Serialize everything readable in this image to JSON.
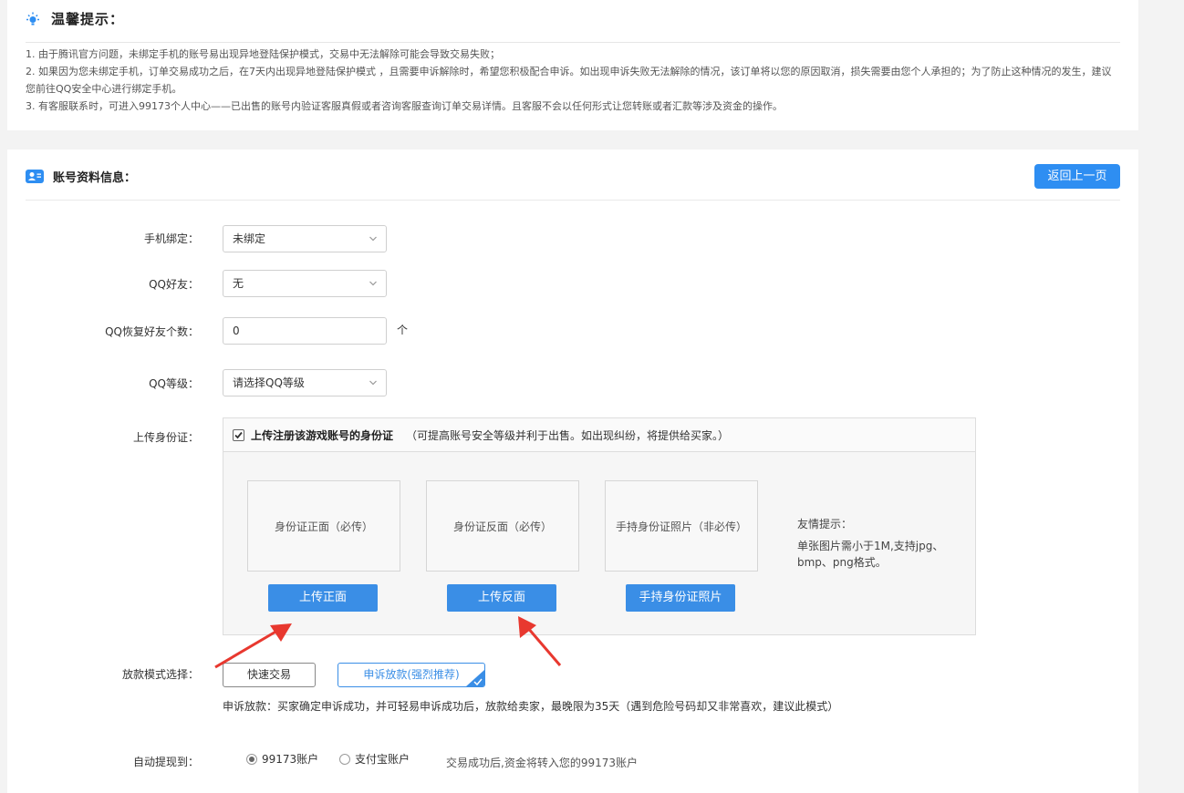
{
  "tips": {
    "title": "温馨提示：",
    "icon": "bulb-icon",
    "lines": [
      "1. 由于腾讯官方问题，未绑定手机的账号易出现异地登陆保护模式，交易中无法解除可能会导致交易失败；",
      "2. 如果因为您未绑定手机，订单交易成功之后，在7天内出现异地登陆保护模式 ，且需要申诉解除时，希望您积极配合申诉。如出现申诉失败无法解除的情况，该订单将以您的原因取消，损失需要由您个人承担的；为了防止这种情况的发生，建议您前往QQ安全中心进行绑定手机。",
      "3. 有客服联系时，可进入99173个人中心——已出售的账号内验证客服真假或者咨询客服查询订单交易详情。且客服不会以任何形式让您转账或者汇款等涉及资金的操作。"
    ]
  },
  "account_info": {
    "title": "账号资料信息：",
    "icon": "user-card-icon",
    "back_label": "返回上一页"
  },
  "form": {
    "phone_bind": {
      "label": "手机绑定：",
      "value": "未绑定"
    },
    "qq_friends": {
      "label": "QQ好友：",
      "value": "无"
    },
    "qq_restore": {
      "label": "QQ恢复好友个数：",
      "value": "0",
      "unit": "个"
    },
    "qq_level": {
      "label": "QQ等级：",
      "value": "请选择QQ等级"
    },
    "id_upload": {
      "label": "上传身份证：",
      "checkbox_label": "上传注册该游戏账号的身份证",
      "checkbox_checked": true,
      "checkbox_note": "（可提高账号安全等级并利于出售。如出现纠纷，将提供给买家。）",
      "slots": [
        {
          "placeholder": "身份证正面（必传）",
          "button": "上传正面"
        },
        {
          "placeholder": "身份证反面（必传）",
          "button": "上传反面"
        },
        {
          "placeholder": "手持身份证照片（非必传）",
          "button": "手持身份证照片"
        }
      ],
      "hint_title": "友情提示：",
      "hint_text": "单张图片需小于1M,支持jpg、bmp、png格式。"
    },
    "payout_mode": {
      "label": "放款模式选择：",
      "options": [
        "快速交易",
        "申诉放款(强烈推荐)"
      ],
      "selected": "申诉放款(强烈推荐)",
      "description": "申诉放款：买家确定申诉成功，并可轻易申诉成功后，放款给卖家，最晚限为35天（遇到危险号码却又非常喜欢，建议此模式）"
    },
    "auto_withdraw": {
      "label": "自动提现到：",
      "options": [
        "99173账户",
        "支付宝账户"
      ],
      "selected": "99173账户",
      "note": "交易成功后,资金将转入您的99173账户"
    }
  },
  "colors": {
    "accent": "#2e8ef2",
    "upload_button": "#3a8ee6",
    "arrow": "#e8382f"
  }
}
